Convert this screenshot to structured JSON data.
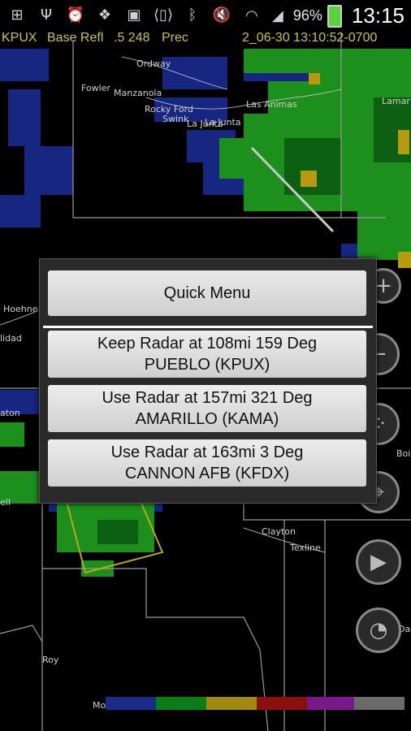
{
  "status_bar": {
    "icons": [
      "add-icon",
      "usb-icon",
      "alarm-icon",
      "dropbox-icon",
      "gallery-icon",
      "vibrate-icon",
      "bluetooth-icon",
      "mute-icon",
      "wifi-icon",
      "signal-icon"
    ],
    "battery_percent": "96%",
    "battery_level": 0.96,
    "time": "13:15"
  },
  "radar_info": {
    "station": "KPUX",
    "product": "Base Refl",
    "tilt": ".5 248",
    "mode": "Prec",
    "timestamp": "2_06-30 13:10:52-0700"
  },
  "map_labels": [
    "Ordway",
    "Fowler",
    "Manzanola",
    "Rocky Ford",
    "Swink",
    "La Junta",
    "La Junta",
    "Las Animas",
    "Lamar",
    "Hoehne",
    "lidad",
    "aton",
    "Clayton",
    "Texline",
    "Roy",
    "Mo",
    "Boi",
    "Da",
    "ell"
  ],
  "quick_menu": {
    "title": "Quick Menu",
    "options": [
      {
        "line1": "Keep Radar at 108mi 159 Deg",
        "line2": "PUEBLO (KPUX)"
      },
      {
        "line1": "Use Radar at 157mi 321 Deg",
        "line2": "AMARILLO (KAMA)"
      },
      {
        "line1": "Use Radar at 163mi 3 Deg",
        "line2": "CANNON AFB (KFDX)"
      }
    ]
  },
  "side_controls": [
    "zoom-in-icon",
    "zoom-out-icon",
    "layers-icon",
    "location-icon",
    "play-icon",
    "compass-icon"
  ],
  "colors": {
    "legend": [
      "#1c2a8a",
      "#0b7d16",
      "#a08a10",
      "#8a0f0f",
      "#7a1a8a",
      "#6a6a6a"
    ]
  }
}
